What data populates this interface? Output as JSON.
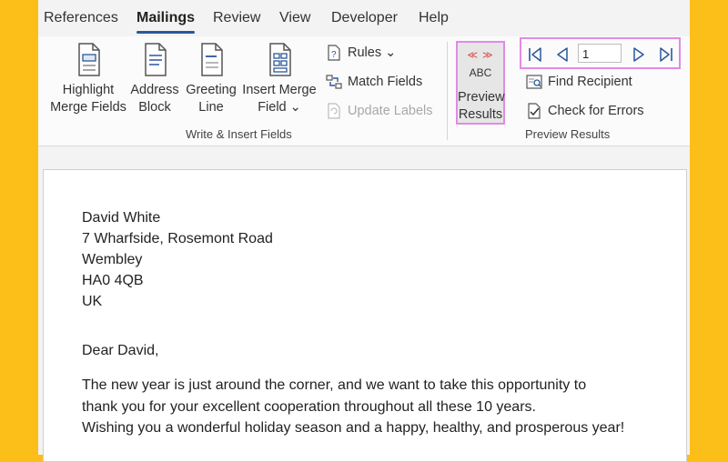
{
  "tabs": [
    {
      "label": "References",
      "active": false
    },
    {
      "label": "Mailings",
      "active": true
    },
    {
      "label": "Review",
      "active": false
    },
    {
      "label": "View",
      "active": false
    },
    {
      "label": "Developer",
      "active": false
    },
    {
      "label": "Help",
      "active": false
    }
  ],
  "ribbon": {
    "write_insert": {
      "group_label": "Write & Insert Fields",
      "highlight": {
        "line1": "Highlight",
        "line2": "Merge Fields"
      },
      "address_block": {
        "line1": "Address",
        "line2": "Block"
      },
      "greeting_line": {
        "line1": "Greeting",
        "line2": "Line"
      },
      "insert_merge": {
        "line1": "Insert Merge",
        "line2": "Field ⌄"
      },
      "rules": "Rules ⌄",
      "match_fields": "Match Fields",
      "update_labels": "Update Labels"
    },
    "preview": {
      "group_label": "Preview Results",
      "preview_icon_text": "ABC",
      "preview_icon_marks": "≪ ≫",
      "preview_button": {
        "line1": "Preview",
        "line2": "Results"
      },
      "record_value": "1",
      "find_recipient": "Find Recipient",
      "check_errors": "Check for Errors"
    },
    "accent_color": "#2b579a",
    "highlight_color": "#e28ae6"
  },
  "document": {
    "address": [
      "David White",
      "7 Wharfside, Rosemont Road",
      "Wembley",
      "HA0 4QB",
      "UK"
    ],
    "greeting": "Dear David,",
    "body": [
      "The new year is just around the corner, and we want to take this opportunity to",
      "thank you for your excellent cooperation throughout all these 10 years.",
      "Wishing you a wonderful holiday season and a happy, healthy, and prosperous year!"
    ]
  }
}
